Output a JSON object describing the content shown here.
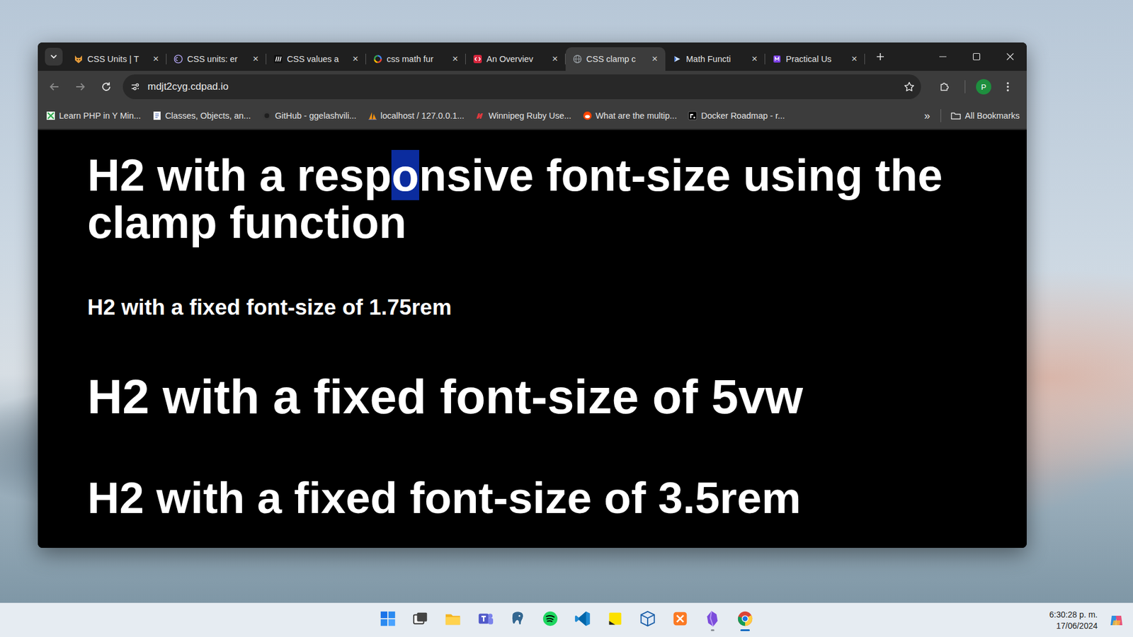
{
  "tabs": [
    {
      "label": "CSS Units | T",
      "selected": false
    },
    {
      "label": "CSS units: er",
      "selected": false
    },
    {
      "label": "CSS values a",
      "selected": false
    },
    {
      "label": "css math fur",
      "selected": false
    },
    {
      "label": "An Overviev",
      "selected": false
    },
    {
      "label": "CSS clamp c",
      "selected": true
    },
    {
      "label": "Math Functi",
      "selected": false
    },
    {
      "label": "Practical Us",
      "selected": false
    }
  ],
  "tab_close": "×",
  "address": {
    "url": "mdjt2cyg.cdpad.io"
  },
  "profile": {
    "initial": "P"
  },
  "bookmarks": [
    {
      "label": "Learn PHP in Y Min..."
    },
    {
      "label": "Classes, Objects, an..."
    },
    {
      "label": "GitHub - ggelashvili..."
    },
    {
      "label": "localhost / 127.0.0.1..."
    },
    {
      "label": "Winnipeg Ruby Use..."
    },
    {
      "label": "What are the multip..."
    },
    {
      "label": "Docker Roadmap - r..."
    }
  ],
  "bookmarks_overflow": "»",
  "all_bookmarks": "All Bookmarks",
  "headings": [
    {
      "segments": [
        {
          "text": "H2 with a resp",
          "selected": false
        },
        {
          "text": "o",
          "selected": true
        },
        {
          "text": "nsive font-size using the clamp function",
          "selected": false
        }
      ]
    },
    {
      "segments": [
        {
          "text": "H2 with a fixed font-size of 1.75rem",
          "selected": false
        }
      ]
    },
    {
      "segments": [
        {
          "text": "H2 with a fixed font-size of 5vw",
          "selected": false
        }
      ]
    },
    {
      "segments": [
        {
          "text": "H2 with a fixed font-size of 3.5rem",
          "selected": false
        }
      ]
    }
  ],
  "taskbar": {
    "apps": [
      {
        "running": false,
        "active": false
      },
      {
        "running": false,
        "active": false
      },
      {
        "running": false,
        "active": false
      },
      {
        "running": false,
        "active": false
      },
      {
        "running": false,
        "active": false
      },
      {
        "running": false,
        "active": false
      },
      {
        "running": false,
        "active": false
      },
      {
        "running": false,
        "active": false
      },
      {
        "running": false,
        "active": false
      },
      {
        "running": false,
        "active": false
      },
      {
        "running": true,
        "active": false
      },
      {
        "running": true,
        "active": true
      }
    ]
  },
  "clock": {
    "time": "6:30:28 p. m.",
    "date": "17/06/2024"
  }
}
